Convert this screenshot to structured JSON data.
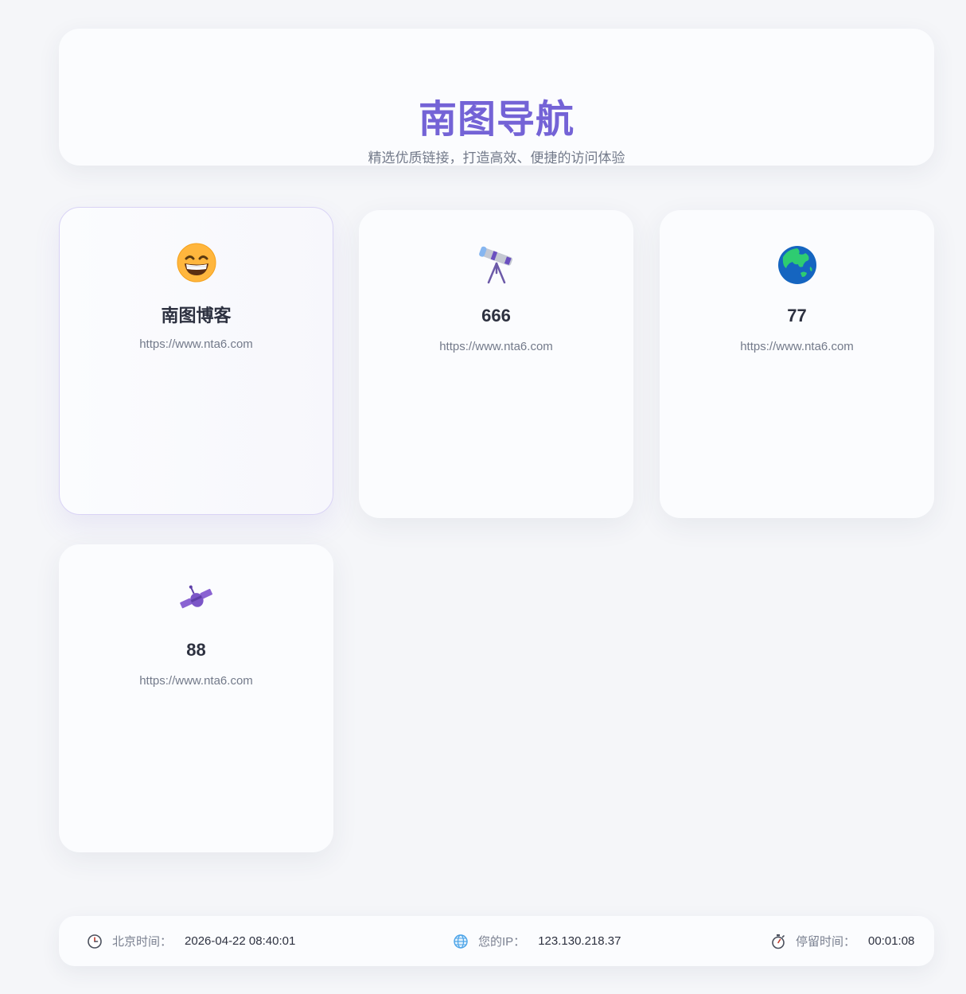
{
  "header": {
    "title": "南图导航",
    "subtitle": "精选优质链接，打造高效、便捷的访问体验"
  },
  "cards": [
    {
      "name": "南图博客",
      "url": "https://www.nta6.com",
      "icon": "grinning-face-icon"
    },
    {
      "name": "666",
      "url": "https://www.nta6.com",
      "icon": "telescope-icon"
    },
    {
      "name": "77",
      "url": "https://www.nta6.com",
      "icon": "globe-asia-icon"
    },
    {
      "name": "88",
      "url": "https://www.nta6.com",
      "icon": "satellite-icon"
    }
  ],
  "footer": {
    "time_label": "北京时间：",
    "time_value": "2026-04-22 08:40:01",
    "ip_label": "您的IP：",
    "ip_value": "123.130.218.37",
    "stay_label": "停留时间：",
    "stay_value": "00:01:08"
  },
  "colors": {
    "accent": "#7463d6",
    "background": "#f5f6f9",
    "card": "#fbfcfe",
    "muted_text": "#737a8a"
  }
}
